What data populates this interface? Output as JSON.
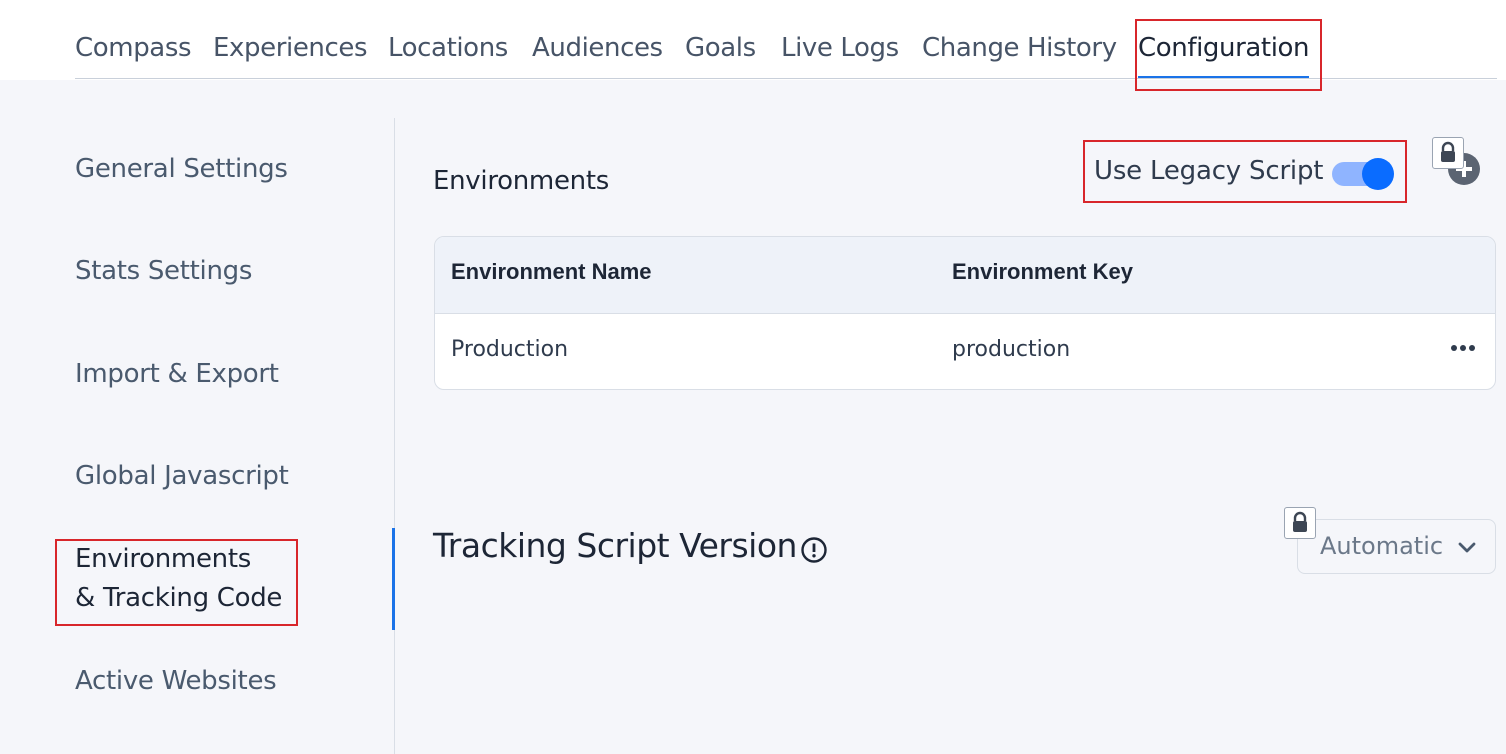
{
  "nav": {
    "tabs": [
      {
        "label": "Compass"
      },
      {
        "label": "Experiences"
      },
      {
        "label": "Locations"
      },
      {
        "label": "Audiences"
      },
      {
        "label": "Goals"
      },
      {
        "label": "Live Logs"
      },
      {
        "label": "Change History"
      },
      {
        "label": "Configuration",
        "active": true
      }
    ]
  },
  "sidebar": {
    "items": [
      {
        "label": "General Settings"
      },
      {
        "label": "Stats Settings"
      },
      {
        "label": "Import & Export"
      },
      {
        "label": "Global Javascript"
      },
      {
        "label_line1": "Environments",
        "label_line2": "& Tracking Code",
        "active": true
      },
      {
        "label": "Active Websites"
      }
    ]
  },
  "environments": {
    "title": "Environments",
    "legacy_toggle_label": "Use Legacy Script",
    "legacy_toggle_on": true,
    "columns": [
      "Environment Name",
      "Environment Key"
    ],
    "rows": [
      {
        "name": "Production",
        "key": "production"
      }
    ]
  },
  "tracking": {
    "title": "Tracking Script Version",
    "version_selected": "Automatic"
  },
  "colors": {
    "accent": "#1a73e8",
    "toggle_track": "#8fb4ff",
    "toggle_knob": "#0a6cff",
    "highlight": "#d8262b"
  },
  "icons": [
    "lock-icon",
    "plus-circle-icon",
    "more-horizontal-icon",
    "info-circle-icon",
    "chevron-down-icon"
  ]
}
